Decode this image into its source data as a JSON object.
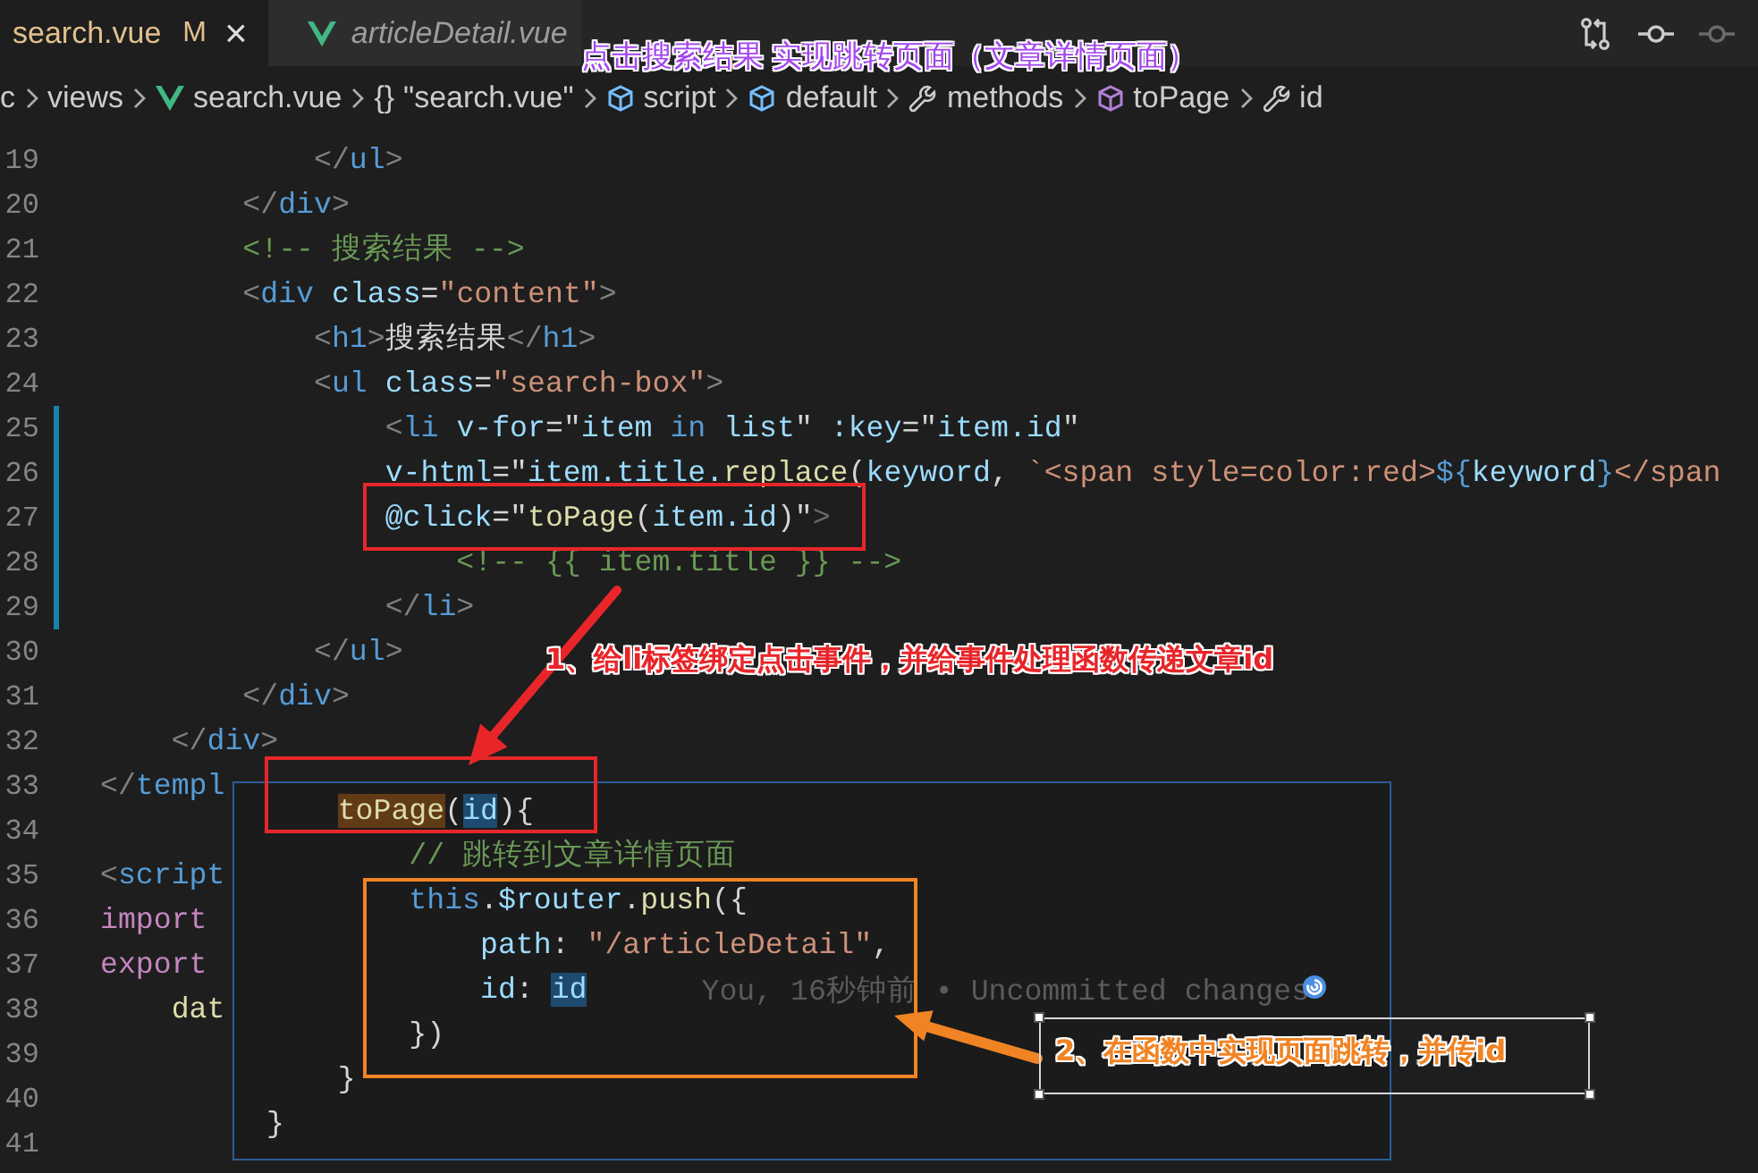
{
  "tabs": [
    {
      "label": "search.vue",
      "selected": true,
      "preview": false,
      "badge": "M",
      "close": "×"
    },
    {
      "label": "articleDetail.vue",
      "selected": false,
      "preview": true
    }
  ],
  "toolbar_actions": [
    {
      "kind": "compare",
      "disabled": false
    },
    {
      "kind": "commit",
      "disabled": false
    },
    {
      "kind": "commit",
      "disabled": true
    }
  ],
  "breadcrumb": [
    {
      "kind": "folder",
      "label": "c"
    },
    {
      "kind": "folder",
      "label": "views"
    },
    {
      "kind": "vue",
      "label": "search.vue"
    },
    {
      "kind": "braces",
      "glyph": "{}",
      "label": "\"search.vue\""
    },
    {
      "kind": "module",
      "label": "script"
    },
    {
      "kind": "module",
      "label": "default"
    },
    {
      "kind": "property",
      "label": "methods"
    },
    {
      "kind": "method",
      "label": "toPage"
    },
    {
      "kind": "property",
      "label": "id"
    }
  ],
  "caption": "点击搜索结果 实现跳转页面（文章详情页面）",
  "editor": {
    "lines": [
      {
        "number": "19",
        "modified": false,
        "tokens": [
          {
            "kind": "p",
            "text": "            </"
          },
          {
            "kind": "tag",
            "text": "ul"
          },
          {
            "kind": "p",
            "text": ">"
          }
        ]
      },
      {
        "number": "20",
        "modified": false,
        "tokens": [
          {
            "kind": "p",
            "text": "        </"
          },
          {
            "kind": "tag",
            "text": "div"
          },
          {
            "kind": "p",
            "text": ">"
          }
        ]
      },
      {
        "number": "21",
        "modified": false,
        "tokens": [
          {
            "kind": "cm",
            "text": "        <!-- 搜索结果 -->"
          }
        ]
      },
      {
        "number": "22",
        "modified": false,
        "tokens": [
          {
            "kind": "p",
            "text": "        <"
          },
          {
            "kind": "tag",
            "text": "div"
          },
          {
            "kind": "attr",
            "text": " class"
          },
          {
            "kind": "txt",
            "text": "="
          },
          {
            "kind": "str",
            "text": "\"content\""
          },
          {
            "kind": "p",
            "text": ">"
          }
        ]
      },
      {
        "number": "23",
        "modified": false,
        "tokens": [
          {
            "kind": "p",
            "text": "            <"
          },
          {
            "kind": "tag",
            "text": "h1"
          },
          {
            "kind": "p",
            "text": ">"
          },
          {
            "kind": "txt",
            "text": "搜索结果"
          },
          {
            "kind": "p",
            "text": "</"
          },
          {
            "kind": "tag",
            "text": "h1"
          },
          {
            "kind": "p",
            "text": ">"
          }
        ]
      },
      {
        "number": "24",
        "modified": false,
        "tokens": [
          {
            "kind": "p",
            "text": "            <"
          },
          {
            "kind": "tag",
            "text": "ul"
          },
          {
            "kind": "attr",
            "text": " class"
          },
          {
            "kind": "txt",
            "text": "="
          },
          {
            "kind": "str",
            "text": "\"search-box\""
          },
          {
            "kind": "p",
            "text": ">"
          }
        ]
      },
      {
        "number": "25",
        "modified": true,
        "tokens": [
          {
            "kind": "p",
            "text": "                <"
          },
          {
            "kind": "tag",
            "text": "li"
          },
          {
            "kind": "attr",
            "text": " v-for"
          },
          {
            "kind": "txt",
            "text": "=\""
          },
          {
            "kind": "var",
            "text": "item"
          },
          {
            "kind": "tag",
            "text": " in "
          },
          {
            "kind": "var",
            "text": "list"
          },
          {
            "kind": "txt",
            "text": "\" "
          },
          {
            "kind": "attr",
            "text": ":key"
          },
          {
            "kind": "txt",
            "text": "=\""
          },
          {
            "kind": "var",
            "text": "item.id"
          },
          {
            "kind": "txt",
            "text": "\""
          }
        ]
      },
      {
        "number": "26",
        "modified": true,
        "tokens": [
          {
            "kind": "attr",
            "text": "                v-html"
          },
          {
            "kind": "txt",
            "text": "=\""
          },
          {
            "kind": "var",
            "text": "item.title."
          },
          {
            "kind": "fn",
            "text": "replace"
          },
          {
            "kind": "txt",
            "text": "("
          },
          {
            "kind": "var",
            "text": "keyword"
          },
          {
            "kind": "txt",
            "text": ", "
          },
          {
            "kind": "str",
            "text": "`<span style=color:red>"
          },
          {
            "kind": "tag",
            "text": "${"
          },
          {
            "kind": "var",
            "text": "keyword"
          },
          {
            "kind": "tag",
            "text": "}"
          },
          {
            "kind": "str",
            "text": "</span"
          }
        ]
      },
      {
        "number": "27",
        "modified": true,
        "tokens": [
          {
            "kind": "attr",
            "text": "                @click"
          },
          {
            "kind": "txt",
            "text": "=\""
          },
          {
            "kind": "fn",
            "text": "toPage"
          },
          {
            "kind": "txt",
            "text": "("
          },
          {
            "kind": "var",
            "text": "item.id"
          },
          {
            "kind": "txt",
            "text": ")\""
          },
          {
            "kind": "dim",
            "text": ">"
          }
        ]
      },
      {
        "number": "28",
        "modified": true,
        "tokens": [
          {
            "kind": "cm",
            "text": "                    <!-- {{ item.title }} -->"
          }
        ]
      },
      {
        "number": "29",
        "modified": true,
        "tokens": [
          {
            "kind": "p",
            "text": "                </"
          },
          {
            "kind": "tag",
            "text": "li"
          },
          {
            "kind": "p",
            "text": ">"
          }
        ]
      },
      {
        "number": "30",
        "modified": false,
        "tokens": [
          {
            "kind": "p",
            "text": "            </"
          },
          {
            "kind": "tag",
            "text": "ul"
          },
          {
            "kind": "p",
            "text": ">"
          }
        ]
      },
      {
        "number": "31",
        "modified": false,
        "tokens": [
          {
            "kind": "p",
            "text": "        </"
          },
          {
            "kind": "tag",
            "text": "div"
          },
          {
            "kind": "p",
            "text": ">"
          }
        ]
      },
      {
        "number": "32",
        "modified": false,
        "tokens": [
          {
            "kind": "p",
            "text": "    </"
          },
          {
            "kind": "tag",
            "text": "div"
          },
          {
            "kind": "p",
            "text": ">"
          }
        ]
      },
      {
        "number": "33",
        "modified": false,
        "tokens": [
          {
            "kind": "p",
            "text": "</"
          },
          {
            "kind": "tag",
            "text": "templ"
          }
        ]
      },
      {
        "number": "34",
        "modified": false
      },
      {
        "number": "35",
        "modified": false,
        "tokens": [
          {
            "kind": "p",
            "text": "<"
          },
          {
            "kind": "tag",
            "text": "script"
          }
        ]
      },
      {
        "number": "36",
        "modified": false,
        "tokens": [
          {
            "kind": "kw",
            "text": "import"
          }
        ]
      },
      {
        "number": "37",
        "modified": false,
        "tokens": [
          {
            "kind": "kw",
            "text": "export"
          }
        ]
      },
      {
        "number": "38",
        "modified": false,
        "tokens": [
          {
            "kind": "fn",
            "text": "    dat"
          }
        ]
      },
      {
        "number": "39",
        "modified": false
      },
      {
        "number": "40",
        "modified": false
      },
      {
        "number": "41",
        "modified": false
      }
    ]
  },
  "peek": {
    "lines": [
      {
        "tokens": [
          {
            "kind": "fnhl",
            "text": "    toPage"
          },
          {
            "kind": "txt",
            "text": "("
          },
          {
            "kind": "varhl",
            "text": "id"
          },
          {
            "kind": "txt",
            "text": "){"
          }
        ]
      },
      {
        "tokens": [
          {
            "kind": "cm",
            "text": "        // 跳转到文章详情页面"
          }
        ]
      },
      {
        "tokens": [
          {
            "kind": "tag",
            "text": "        this"
          },
          {
            "kind": "txt",
            "text": "."
          },
          {
            "kind": "var",
            "text": "$router"
          },
          {
            "kind": "txt",
            "text": "."
          },
          {
            "kind": "fn",
            "text": "push"
          },
          {
            "kind": "txt",
            "text": "({"
          }
        ]
      },
      {
        "tokens": [
          {
            "kind": "attr",
            "text": "            path"
          },
          {
            "kind": "txt",
            "text": ": "
          },
          {
            "kind": "str",
            "text": "\"/articleDetail\""
          },
          {
            "kind": "txt",
            "text": ","
          }
        ]
      },
      {
        "tokens": [
          {
            "kind": "attr",
            "text": "            id"
          },
          {
            "kind": "txt",
            "text": ": "
          },
          {
            "kind": "varhl",
            "text": "id"
          }
        ],
        "blame": "You, 16秒钟前 • Uncommitted changes"
      },
      {
        "tokens": [
          {
            "kind": "txt",
            "text": "        })"
          }
        ]
      },
      {
        "tokens": [
          {
            "kind": "txt",
            "text": "    }"
          }
        ]
      },
      {
        "tokens": [
          {
            "kind": "txt",
            "text": "}"
          }
        ]
      }
    ]
  },
  "notes": [
    {
      "text": "1、给li标签绑定点击事件，并给事件处理函数传递文章id",
      "color": "#e8262a"
    },
    {
      "text": "2、在函数中实现页面跳转，并传id",
      "color": "#f08424"
    }
  ]
}
